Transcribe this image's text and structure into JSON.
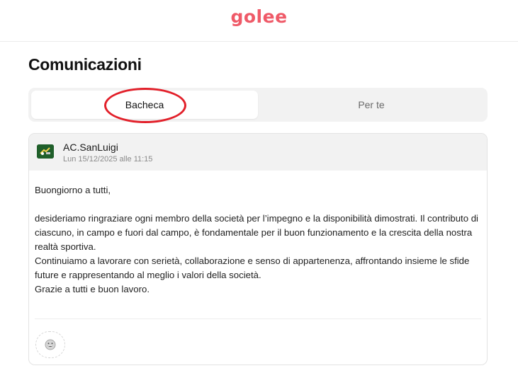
{
  "header": {
    "logo": "golee"
  },
  "page": {
    "title": "Comunicazioni"
  },
  "tabs": [
    {
      "label": "Bacheca",
      "active": true
    },
    {
      "label": "Per te",
      "active": false
    }
  ],
  "post": {
    "author": "AC.SanLuigi",
    "date": "Lun 15/12/2025 alle 11:15",
    "greeting": "Buongiorno a tutti,",
    "paragraph1": "desideriamo ringraziare ogni membro della società per l’impegno e la disponibilità dimostrati. Il contributo di ciascuno, in campo e fuori dal campo, è fondamentale per il buon funzionamento e la crescita della nostra realtà sportiva.",
    "paragraph2": "Continuiamo a lavorare con serietà, collaborazione e senso di appartenenza, affrontando insieme le sfide future e rappresentando al meglio i valori della società.",
    "closing": "Grazie a tutti e buon lavoro."
  },
  "icons": {
    "reaction": "emoji-reaction-icon",
    "avatar": "club-logo"
  },
  "colors": {
    "brand": "#ef5a68",
    "highlight": "#e2202a",
    "avatar_bg": "#1f5f2a"
  }
}
